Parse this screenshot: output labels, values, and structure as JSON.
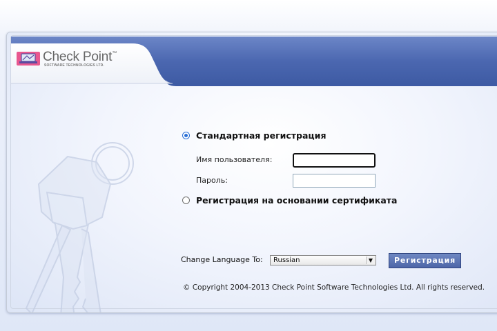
{
  "brand": {
    "name": "Check Point",
    "trademark": "™",
    "subtitle": "SOFTWARE TECHNOLOGIES LTD."
  },
  "login": {
    "standard_option": "Стандартная регистрация",
    "username_label": "Имя пользователя:",
    "username_value": "",
    "password_label": "Пароль:",
    "password_value": "",
    "certificate_option": "Регистрация на основании сертификата",
    "selected_method": "standard"
  },
  "language": {
    "label": "Change Language To:",
    "selected": "Russian"
  },
  "actions": {
    "submit_label": "Регистрация"
  },
  "footer": {
    "copyright": "© Copyright 2004-2013   Check Point Software Technologies Ltd. All rights reserved."
  },
  "colors": {
    "header_blue": "#4a66b0",
    "button_blue": "#5a72b2",
    "radio_accent": "#2a6fd6",
    "logo_pink": "#e8578f"
  }
}
